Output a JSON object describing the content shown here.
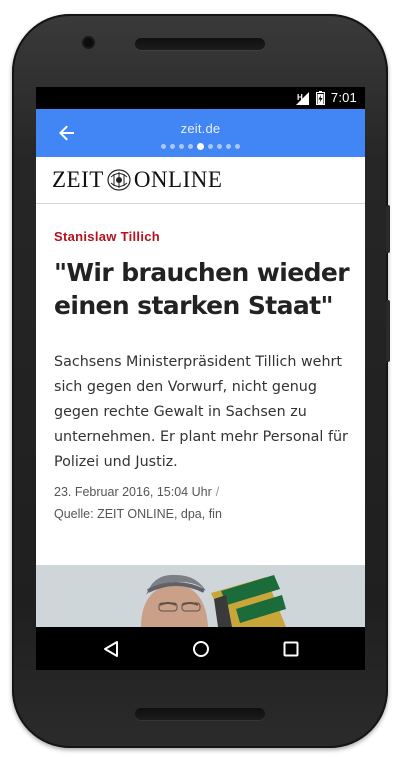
{
  "status_bar": {
    "time": "7:01",
    "signal_badge": "H",
    "icons": [
      "signal-icon",
      "battery-icon"
    ]
  },
  "toolbar": {
    "url": "zeit.de",
    "back_icon": "arrow-left-icon",
    "page_dots": {
      "count": 9,
      "active_index": 4
    },
    "color": "#4285f4"
  },
  "masthead": {
    "logo_left": "ZEIT",
    "logo_right": "ONLINE"
  },
  "article": {
    "kicker": "Stanislaw Tillich",
    "headline": "\"Wir brauchen wieder einen starken Staat\"",
    "teaser": "Sachsens Ministerpräsident Tillich wehrt sich gegen den Vorwurf, nicht genug gegen rechte Gewalt in Sachsen zu unternehmen. Er plant mehr Personal für Polizei und Justiz.",
    "date": "23. Februar 2016, 15:04 Uhr",
    "separator": "/",
    "source": "Quelle: ZEIT ONLINE, dpa, fin",
    "kicker_color": "#b6121b"
  },
  "nav_bar": {
    "buttons": [
      "back-triangle-icon",
      "home-circle-icon",
      "recents-square-icon"
    ]
  }
}
